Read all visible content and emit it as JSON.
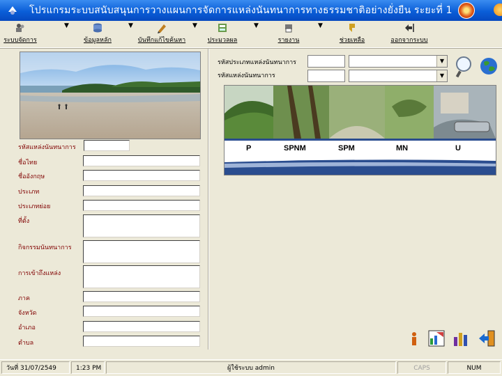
{
  "window": {
    "title": "โปรแกรมระบบสนับสนุนการวางแผนการจัดการแหล่งนันทนาการทางธรรมชาติอย่างยั่งยืน ระยะที่ 1"
  },
  "toolbar": {
    "items": [
      {
        "label": "ระบบจัดการ",
        "icon": "people-icon"
      },
      {
        "label": "ข้อมูลหลัก",
        "icon": "database-icon"
      },
      {
        "label": "บันทึกแก้ไขค้นหา",
        "icon": "edit-icon"
      },
      {
        "label": "ประมวลผล",
        "icon": "process-icon"
      },
      {
        "label": "รายงาน",
        "icon": "report-icon"
      },
      {
        "label": "ช่วยเหลือ",
        "icon": "help-icon"
      },
      {
        "label": "ออกจากระบบ",
        "icon": "exit-icon"
      }
    ]
  },
  "form": {
    "fields": [
      {
        "label": "รหัสแหล่งนันทนาการ",
        "value": ""
      },
      {
        "label": "ชื่อไทย",
        "value": ""
      },
      {
        "label": "ชื่ออังกฤษ",
        "value": ""
      },
      {
        "label": "ประเภท",
        "value": ""
      },
      {
        "label": "ประเภทย่อย",
        "value": ""
      },
      {
        "label": "ที่ตั้ง",
        "value": ""
      },
      {
        "label": "กิจกรรมนันทนาการ",
        "value": ""
      },
      {
        "label": "การเข้าถึงแหล่ง",
        "value": ""
      },
      {
        "label": "ภาค",
        "value": ""
      },
      {
        "label": "จังหวัด",
        "value": ""
      },
      {
        "label": "อำเภอ",
        "value": ""
      },
      {
        "label": "ตำบล",
        "value": ""
      }
    ]
  },
  "search": {
    "type_code_label": "รหัสประเภทแหล่งนันทนาการ",
    "site_code_label": "รหัสแหล่งนันทนาการ",
    "type_code_value": "",
    "type_name_value": "",
    "site_code_value": "",
    "site_name_value": ""
  },
  "banner": {
    "labels": [
      "P",
      "SPNM",
      "SPM",
      "MN",
      "U"
    ]
  },
  "status": {
    "date": "วันที่ 31/07/2549",
    "time": "1:23 PM",
    "user": "ผู้ใช้ระบบ admin",
    "caps": "CAPS",
    "num": "NUM"
  },
  "colors": {
    "titlebar": "#0a5ed8",
    "label": "#800000",
    "banner_bar": "#2a4d8f"
  }
}
